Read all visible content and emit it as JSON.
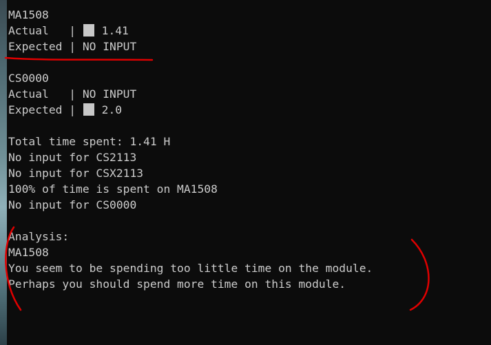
{
  "blocks": [
    {
      "code": "MA1508",
      "actual_label": "Actual   | ",
      "actual_value": "1.41",
      "expected_label": "Expected | ",
      "expected_value": "NO INPUT"
    },
    {
      "code": "CS0000",
      "actual_label": "Actual   | ",
      "actual_value": "NO INPUT",
      "expected_label": "Expected | ",
      "expected_value": "2.0"
    }
  ],
  "summary": [
    "Total time spent: 1.41 H",
    "No input for CS2113",
    "No input for CSX2113",
    "100% of time is spent on MA1508",
    "No input for CS0000"
  ],
  "analysis": {
    "heading": "Analysis:",
    "module": "MA1508",
    "lines": [
      "You seem to be spending too little time on the module.",
      "Perhaps you should spend more time on this module."
    ]
  },
  "colors": {
    "background": "#0c0c0c",
    "text": "#cccccc",
    "annotation": "#e00000"
  }
}
